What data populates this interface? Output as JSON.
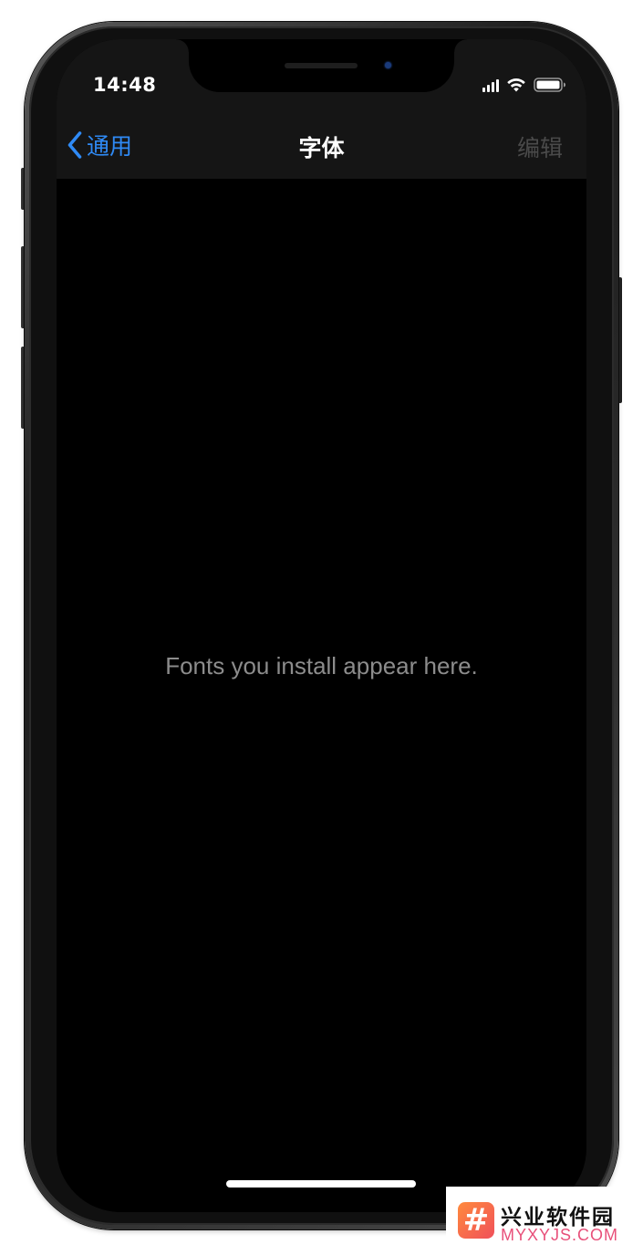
{
  "status_bar": {
    "time": "14:48"
  },
  "nav": {
    "back_label": "通用",
    "title": "字体",
    "edit_label": "编辑"
  },
  "content": {
    "empty_message": "Fonts you install appear here."
  },
  "watermark": {
    "name": "兴业软件园",
    "url": "MYXYJS.COM",
    "logo_glyph": "#"
  },
  "colors": {
    "accent_blue": "#2f8af5",
    "nav_background": "#151515",
    "screen_background": "#000000",
    "disabled_text": "#4a4a4a",
    "secondary_text": "#8c8c8c"
  },
  "icons": {
    "back": "chevron-left-icon",
    "signal": "cellular-signal-icon",
    "wifi": "wifi-icon",
    "battery": "battery-icon"
  }
}
